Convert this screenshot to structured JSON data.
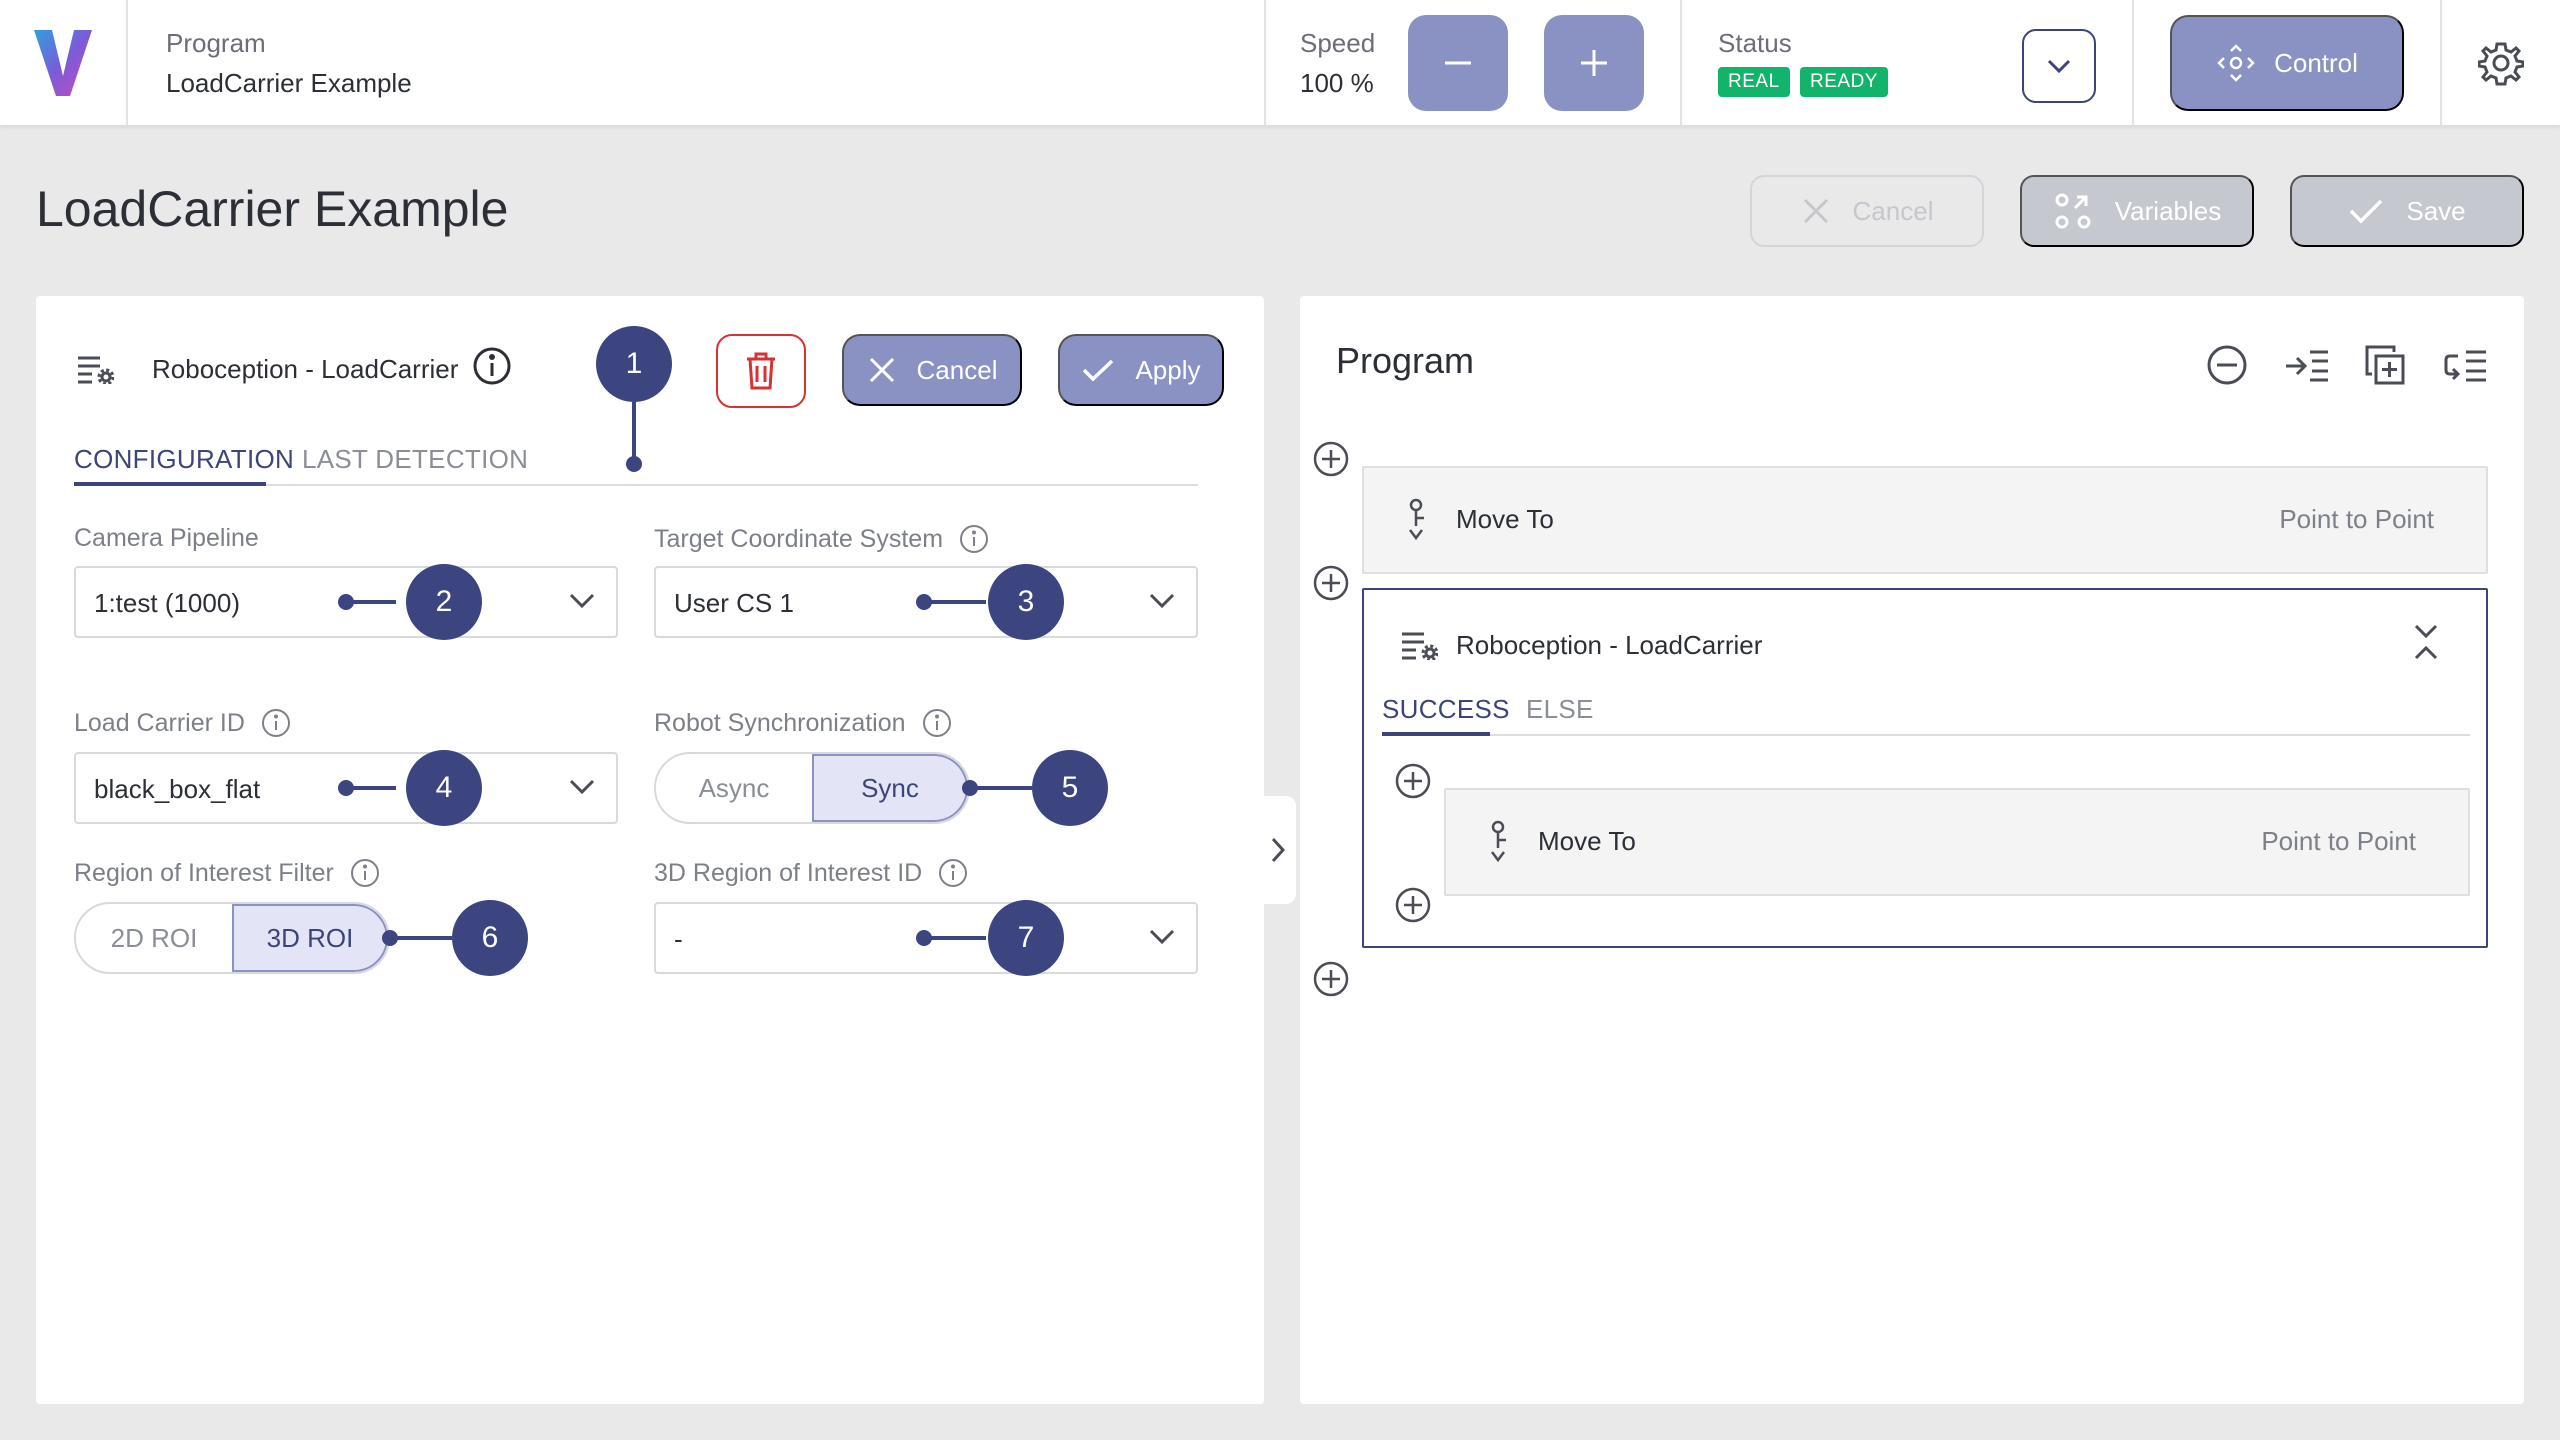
{
  "topbar": {
    "program_label": "Program",
    "program_name": "LoadCarrier Example",
    "speed_label": "Speed",
    "speed_value": "100 %",
    "status_label": "Status",
    "badges": [
      "REAL",
      "READY"
    ],
    "control_label": "Control",
    "colors": {
      "accent": "#8a91c3",
      "dark": "#3b4579",
      "badge": "#12b36a",
      "danger": "#d63232"
    }
  },
  "header": {
    "title": "LoadCarrier Example",
    "cancel_label": "Cancel",
    "variables_label": "Variables",
    "save_label": "Save"
  },
  "node": {
    "title": "Roboception - LoadCarrier",
    "cancel_label": "Cancel",
    "apply_label": "Apply",
    "tabs": [
      "CONFIGURATION",
      "LAST DETECTION"
    ],
    "fields": {
      "camera_pipeline": {
        "label": "Camera Pipeline",
        "value": "1:test (1000)"
      },
      "target_cs": {
        "label": "Target Coordinate System",
        "value": "User CS 1"
      },
      "load_carrier_id": {
        "label": "Load Carrier ID",
        "value": "black_box_flat"
      },
      "robot_sync": {
        "label": "Robot Synchronization",
        "options": [
          "Async",
          "Sync"
        ],
        "selected": "Sync"
      },
      "roi_filter": {
        "label": "Region of Interest Filter",
        "options": [
          "2D ROI",
          "3D ROI"
        ],
        "selected": "3D ROI"
      },
      "roi_3d_id": {
        "label": "3D Region of Interest ID",
        "value": "-"
      }
    },
    "callouts": [
      "1",
      "2",
      "3",
      "4",
      "5",
      "6",
      "7"
    ]
  },
  "program": {
    "title": "Program",
    "blocks": [
      {
        "title": "Move To",
        "type": "Point to Point"
      },
      {
        "title": "Roboception - LoadCarrier",
        "tabs": [
          "SUCCESS",
          "ELSE"
        ],
        "children": [
          {
            "title": "Move To",
            "type": "Point to Point"
          }
        ]
      }
    ]
  }
}
